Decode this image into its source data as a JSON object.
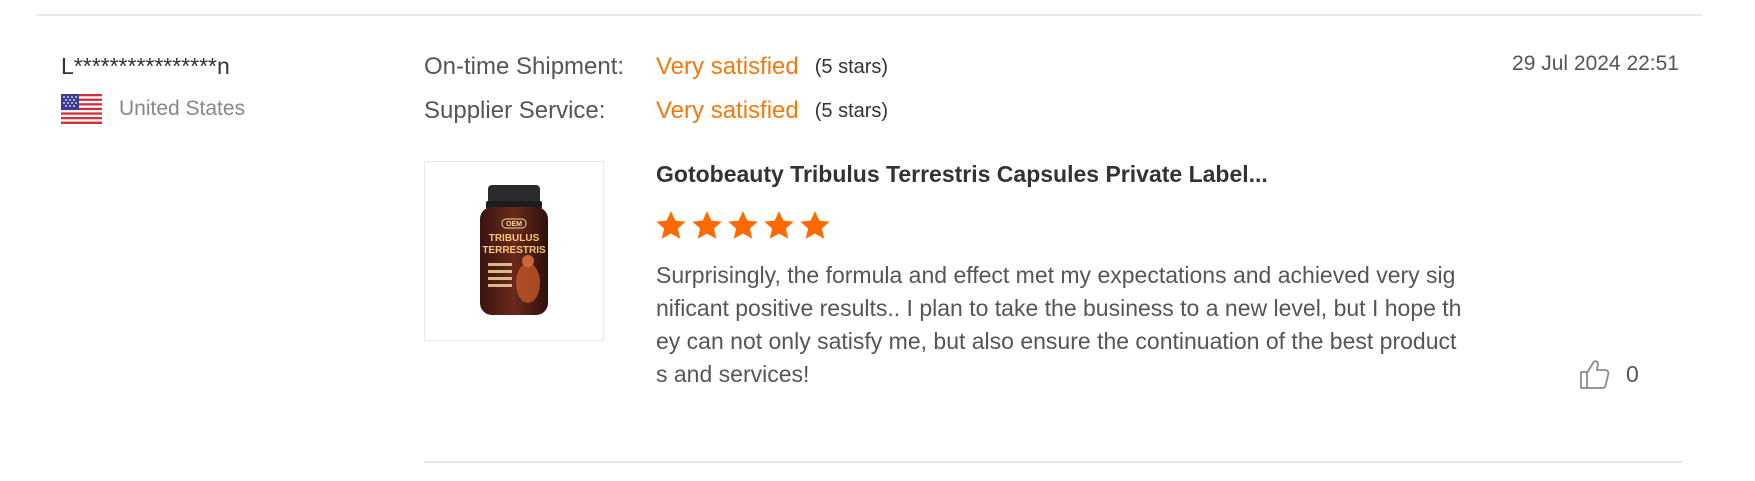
{
  "reviewer": {
    "name": "L****************n",
    "country": "United States",
    "flag_icon": "us-flag-icon"
  },
  "ratings": [
    {
      "label": "On-time Shipment:",
      "value": "Very satisfied",
      "stars_text": "(5 stars)"
    },
    {
      "label": "Supplier Service:",
      "value": "Very satisfied",
      "stars_text": "(5 stars)"
    }
  ],
  "review": {
    "date": "29 Jul 2024 22:51",
    "product_title": "Gotobeauty Tribulus Terrestris Capsules Private Label...",
    "star_rating": 5,
    "star_max": 5,
    "text": "Surprisingly, the formula and effect met my expectations and achieved very significant positive results.. I plan to take the business to a new level, but I hope they can not only satisfy me, but also ensure the continuation of the best products and services!",
    "like_count": "0",
    "like_icon": "thumbs-up-icon"
  },
  "product_image": {
    "brand_badge": "OEM",
    "line1": "TRIBULUS",
    "line2": "TERRESTRIS"
  },
  "colors": {
    "accent": "#f07a10",
    "star": "#ff6a00",
    "divider": "#e8e8e8"
  }
}
